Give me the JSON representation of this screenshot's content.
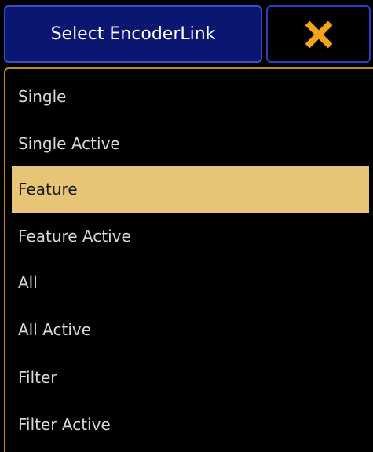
{
  "dialog": {
    "title": "Select EncoderLink",
    "close_icon": "close-x-icon",
    "close_icon_color": "#f2a51a",
    "accent_border": "#c08a20",
    "selected_color": "#e8c576"
  },
  "options": [
    {
      "label": "Single",
      "selected": false
    },
    {
      "label": "Single Active",
      "selected": false
    },
    {
      "label": "Feature",
      "selected": true
    },
    {
      "label": "Feature Active",
      "selected": false
    },
    {
      "label": "All",
      "selected": false
    },
    {
      "label": "All Active",
      "selected": false
    },
    {
      "label": "Filter",
      "selected": false
    },
    {
      "label": "Filter Active",
      "selected": false
    }
  ]
}
